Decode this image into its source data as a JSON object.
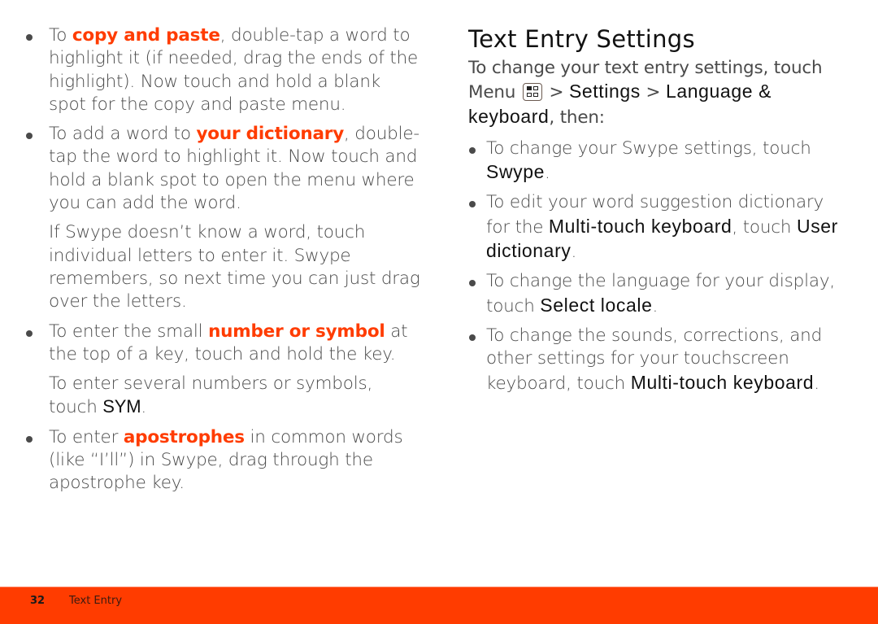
{
  "left": {
    "items": [
      {
        "pre": "To ",
        "hl": "copy and paste",
        "post": ", double-tap a word to highlight it (if needed, drag the ends of the highlight). Now touch and hold a blank spot for the copy and paste menu."
      },
      {
        "pre": "To add a word to ",
        "hl": "your dictionary",
        "post": ", double-tap the word to highlight it. Now touch and hold a blank spot to open the menu where you can add the word."
      },
      {
        "para": "If Swype doesn’t know a word, touch individual letters to enter it. Swype remembers, so next time you can just drag over the letters."
      },
      {
        "pre": "To enter the small ",
        "hl": "number or symbol",
        "post": " at the top of a key, touch and hold the key."
      },
      {
        "pre": "To enter several numbers or symbols, touch ",
        "ui": "SYM",
        "post": "."
      },
      {
        "pre": "To enter ",
        "hl": "apostrophes",
        "post": " in common words (like “I’ll”) in Swype, drag through the apostrophe key."
      }
    ]
  },
  "right": {
    "title": "Text Entry Settings",
    "intro": {
      "pre": "To change your text entry settings, touch Menu ",
      "menu_icon": "menu-icon",
      "sep1": " > ",
      "settings": "Settings",
      "sep2": " > ",
      "language": "Language & keyboard",
      "post": ", then:"
    },
    "items": [
      {
        "pre": "To change your Swype settings, touch ",
        "ui": "Swype",
        "post": "."
      },
      {
        "pre": "To edit your word suggestion dictionary for the ",
        "ui": "Multi-touch keyboard",
        "mid": ", touch ",
        "ui2": "User dictionary",
        "post": "."
      },
      {
        "pre": "To change the language for your display, touch ",
        "ui": "Select locale",
        "post": "."
      },
      {
        "pre": "To change the sounds, corrections, and other settings for your touchscreen keyboard, touch ",
        "ui": "Multi-touch keyboard",
        "post": "."
      }
    ]
  },
  "footer": {
    "page_number": "32",
    "section": "Text Entry",
    "bar_color": "#ff3c00"
  },
  "colors": {
    "highlight": "#ff3c00",
    "body_text": "#4a4a4a",
    "ui_text": "#111111"
  }
}
